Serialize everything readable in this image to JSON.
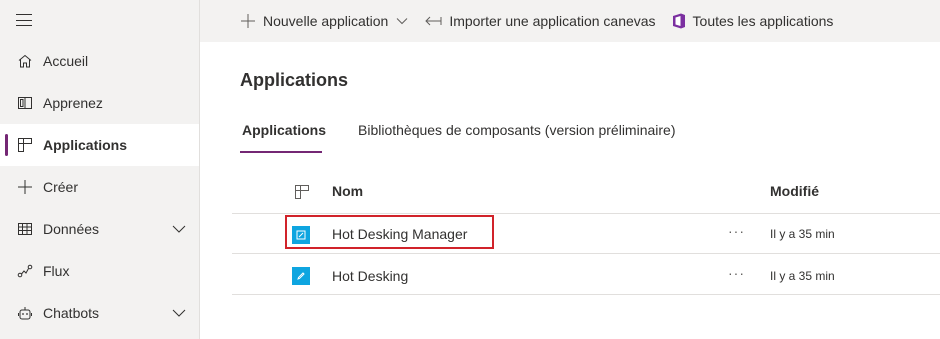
{
  "sidebar": {
    "items": [
      {
        "label": "Accueil",
        "icon": "home-icon"
      },
      {
        "label": "Apprenez",
        "icon": "book-icon"
      },
      {
        "label": "Applications",
        "icon": "apps-icon",
        "active": true
      },
      {
        "label": "Créer",
        "icon": "plus-icon"
      },
      {
        "label": "Données",
        "icon": "table-icon",
        "expandable": true
      },
      {
        "label": "Flux",
        "icon": "flow-icon"
      },
      {
        "label": "Chatbots",
        "icon": "bot-icon",
        "expandable": true
      }
    ]
  },
  "toolbar": {
    "new_app": "Nouvelle application",
    "import_canvas": "Importer une application canevas",
    "all_apps": "Toutes les applications"
  },
  "main": {
    "title": "Applications",
    "tabs": [
      {
        "label": "Applications",
        "active": true
      },
      {
        "label": "Bibliothèques de composants (version préliminaire)"
      }
    ],
    "grid": {
      "columns": {
        "name": "Nom",
        "modified": "Modifié"
      },
      "rows": [
        {
          "name": "Hot Desking Manager",
          "more": "···",
          "modified": "Il y a 35 min",
          "highlighted": true
        },
        {
          "name": "Hot Desking",
          "more": "···",
          "modified": "Il y a 35 min"
        }
      ]
    }
  },
  "colors": {
    "accent": "#742774",
    "app_icon": "#0ea5e0",
    "highlight": "#d1232a",
    "office_icon": "#7b2fa0"
  }
}
